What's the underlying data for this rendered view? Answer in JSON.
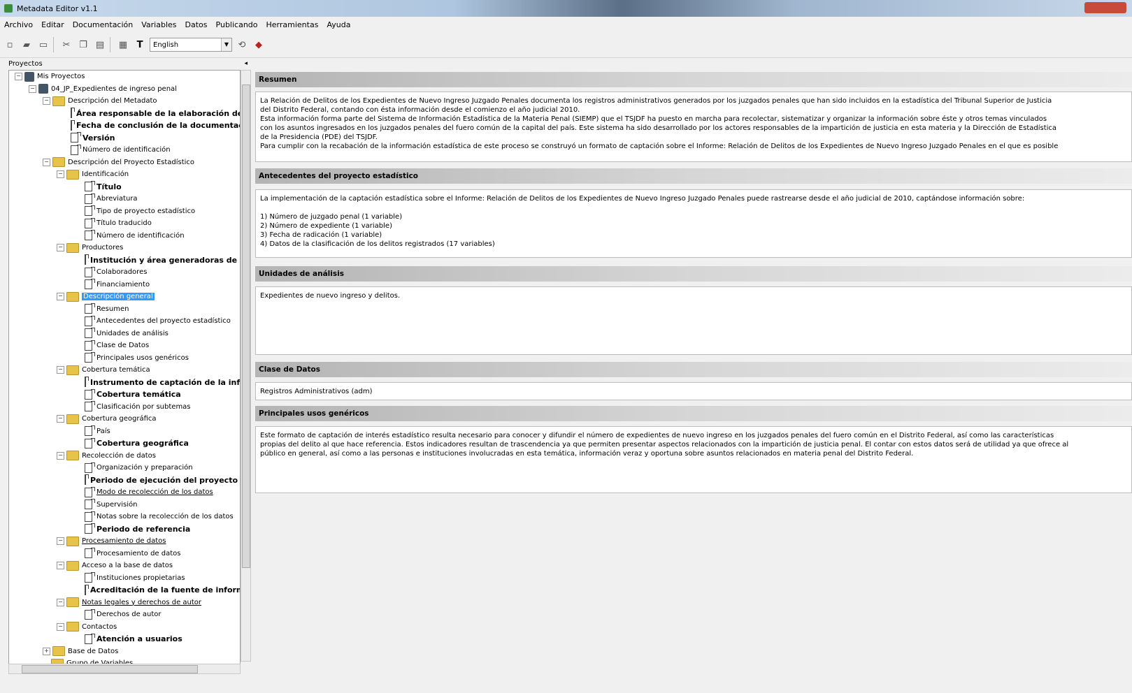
{
  "window": {
    "title": "Metadata Editor v1.1"
  },
  "menu": [
    "Archivo",
    "Editar",
    "Documentación",
    "Variables",
    "Datos",
    "Publicando",
    "Herramientas",
    "Ayuda"
  ],
  "toolbar": {
    "language": "English"
  },
  "left_panel": {
    "title": "Proyectos"
  },
  "tree": [
    {
      "text": "Mis Proyectos",
      "icon": "project"
    },
    {
      "text": "04_JP_Expedientes de ingreso penal",
      "icon": "project"
    },
    {
      "text": "Descripción del Metadato",
      "icon": "folder"
    },
    {
      "text": "Área responsable de la elaboración del r",
      "icon": "doc",
      "bold": true
    },
    {
      "text": "Fecha de conclusión de la documentaci",
      "icon": "doc",
      "bold": true
    },
    {
      "text": "Versión",
      "icon": "doc",
      "bold": true
    },
    {
      "text": "Número de identificación",
      "icon": "doc"
    },
    {
      "text": "Descripción del Proyecto Estadístico",
      "icon": "folder"
    },
    {
      "text": "Identificación",
      "icon": "folder"
    },
    {
      "text": "Título",
      "icon": "doc",
      "bold": true
    },
    {
      "text": "Abreviatura",
      "icon": "doc"
    },
    {
      "text": "Tipo de proyecto estadístico",
      "icon": "doc"
    },
    {
      "text": "Título traducido",
      "icon": "doc"
    },
    {
      "text": "Número de identificación",
      "icon": "doc"
    },
    {
      "text": "Productores",
      "icon": "folder"
    },
    {
      "text": "Institución y área generadoras de la",
      "icon": "doc",
      "bold": true
    },
    {
      "text": "Colaboradores",
      "icon": "doc"
    },
    {
      "text": "Financiamiento",
      "icon": "doc"
    },
    {
      "text": "Descripción general",
      "icon": "folder",
      "selected": true
    },
    {
      "text": "Resumen",
      "icon": "doc"
    },
    {
      "text": "Antecedentes del proyecto estadístico",
      "icon": "doc"
    },
    {
      "text": "Unidades de análisis",
      "icon": "doc"
    },
    {
      "text": "Clase de Datos",
      "icon": "doc"
    },
    {
      "text": "Principales usos genéricos",
      "icon": "doc"
    },
    {
      "text": "Cobertura temática",
      "icon": "folder"
    },
    {
      "text": "Instrumento de captación de la infor",
      "icon": "doc",
      "bold": true
    },
    {
      "text": "Cobertura temática",
      "icon": "doc",
      "bold": true
    },
    {
      "text": "Clasificación por subtemas",
      "icon": "doc"
    },
    {
      "text": "Cobertura geográfica",
      "icon": "folder"
    },
    {
      "text": "País",
      "icon": "doc"
    },
    {
      "text": "Cobertura geográfica",
      "icon": "doc",
      "bold": true
    },
    {
      "text": "Recolección de datos",
      "icon": "folder"
    },
    {
      "text": "Organización y preparación",
      "icon": "doc"
    },
    {
      "text": "Periodo de ejecución del proyecto e",
      "icon": "doc",
      "bold": true
    },
    {
      "text": "Modo de recolección de los datos",
      "icon": "doc",
      "underline": true
    },
    {
      "text": "Supervisión",
      "icon": "doc"
    },
    {
      "text": "Notas sobre la recolección de los datos",
      "icon": "doc"
    },
    {
      "text": "Periodo de referencia",
      "icon": "doc",
      "bold": true
    },
    {
      "text": "Procesamiento de datos",
      "icon": "folder",
      "underline": true
    },
    {
      "text": "Procesamiento de datos",
      "icon": "doc"
    },
    {
      "text": "Acceso a la base de datos",
      "icon": "folder"
    },
    {
      "text": "Instituciones propietarias",
      "icon": "doc"
    },
    {
      "text": "Acreditación de la fuente de informa",
      "icon": "doc",
      "bold": true
    },
    {
      "text": "Notas legales y derechos de autor",
      "icon": "folder",
      "underline": true
    },
    {
      "text": "Derechos de autor",
      "icon": "doc"
    },
    {
      "text": "Contactos",
      "icon": "folder"
    },
    {
      "text": "Atención a usuarios",
      "icon": "doc",
      "bold": true
    },
    {
      "text": "Base de Datos",
      "icon": "folder"
    },
    {
      "text": "Grupo de Variables",
      "icon": "folder"
    }
  ],
  "sections": {
    "resumen": {
      "title": "Resumen",
      "lines": [
        "La Relación de Delitos de los Expedientes de Nuevo Ingreso Juzgado Penales documenta los registros administrativos generados por los juzgados penales que han sido incluidos en la estadística del Tribunal Superior de Justicia",
        "del Distrito Federal, contando con ésta información desde el comienzo el año judicial 2010.",
        "Esta información forma parte del Sistema de Información Estadística de la Materia Penal (SIEMP) que el TSJDF ha puesto en marcha para recolectar, sistematizar y organizar la información sobre éste y otros temas vinculados",
        "con los asuntos ingresados en los juzgados penales del fuero común de la capital del país. Este sistema ha sido desarrollado por los actores responsables de la impartición de justicia en esta materia y la Dirección de Estadística",
        "de la Presidencia (PDE) del TSJDF.",
        "Para cumplir con la recabación de la información estadística de este proceso se construyó un formato de captación sobre el Informe: Relación de Delitos de los Expedientes de Nuevo Ingreso Juzgado Penales en el que es posible"
      ]
    },
    "antecedentes": {
      "title": "Antecedentes del proyecto estadístico",
      "lines": [
        "La implementación de la captación estadística sobre el Informe: Relación de Delitos de los Expedientes de Nuevo Ingreso Juzgado Penales puede rastrearse desde el año judicial de 2010, captándose información sobre:",
        "",
        "1) Número de juzgado penal (1 variable)",
        "2) Número de expediente (1 variable)",
        "3) Fecha de radicación (1 variable)",
        "4) Datos de la clasificación de los delitos registrados (17 variables)"
      ]
    },
    "unidades": {
      "title": "Unidades de análisis",
      "text": "Expedientes de nuevo ingreso y delitos."
    },
    "clase": {
      "title": "Clase de Datos",
      "text": "Registros Administrativos (adm)"
    },
    "usos": {
      "title": "Principales usos genéricos",
      "lines": [
        "Este formato de captación de interés estadístico resulta necesario para conocer y difundir el número de expedientes de nuevo ingreso en los juzgados penales del fuero común en el Distrito Federal, así como las características",
        "propias del delito al que hace referencia. Estos indicadores resultan de trascendencia ya que permiten presentar aspectos relacionados con la impartición de justicia penal. El contar con estos datos será de utilidad ya que ofrece al",
        "público en general, así como a las personas e instituciones involucradas en esta temática, información veraz y oportuna sobre asuntos relacionados en materia penal del Distrito Federal."
      ]
    }
  }
}
